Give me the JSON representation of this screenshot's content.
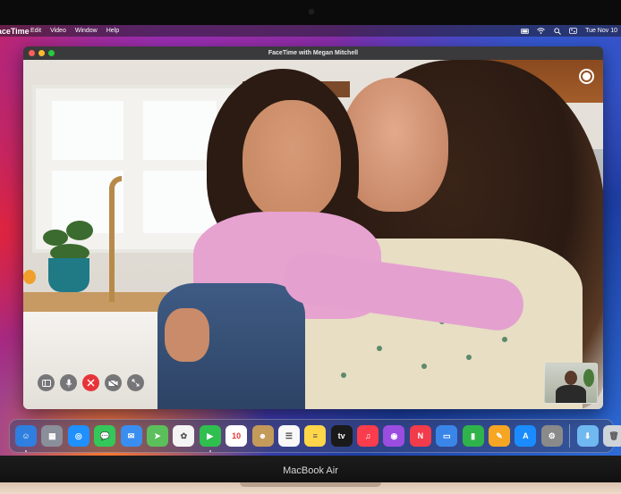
{
  "menubar": {
    "app": "FaceTime",
    "items": [
      "Edit",
      "Video",
      "Window",
      "Help"
    ],
    "clock": "Tue Nov 10",
    "status_icons": [
      "battery-icon",
      "wifi-icon",
      "search-icon",
      "control-center-icon"
    ]
  },
  "window": {
    "title": "FaceTime with Megan Mitchell",
    "controls": [
      "sidebar-icon",
      "mute-icon",
      "end-call-icon",
      "camera-off-icon",
      "fullscreen-icon"
    ],
    "end_color": "#e8333a"
  },
  "dock": {
    "apps": [
      {
        "name": "Finder",
        "icon": "finder-icon",
        "glyph": "☺",
        "color": "#2f7fe0",
        "running": true
      },
      {
        "name": "Launchpad",
        "icon": "launchpad-icon",
        "glyph": "▦",
        "color": "#8a8f99",
        "running": false
      },
      {
        "name": "Safari",
        "icon": "safari-icon",
        "glyph": "◎",
        "color": "#1e90ff",
        "running": false
      },
      {
        "name": "Messages",
        "icon": "messages-icon",
        "glyph": "💬",
        "color": "#34c759",
        "running": false
      },
      {
        "name": "Mail",
        "icon": "mail-icon",
        "glyph": "✉",
        "color": "#3a8ef0",
        "running": false
      },
      {
        "name": "Maps",
        "icon": "maps-icon",
        "glyph": "➤",
        "color": "#5bbf5b",
        "running": false
      },
      {
        "name": "Photos",
        "icon": "photos-icon",
        "glyph": "✿",
        "color": "#f4f4f4",
        "running": false
      },
      {
        "name": "FaceTime",
        "icon": "facetime-icon",
        "glyph": "▶",
        "color": "#2fbf4f",
        "running": true
      },
      {
        "name": "Calendar",
        "icon": "calendar-icon",
        "glyph": "10",
        "color": "#ffffff",
        "running": false
      },
      {
        "name": "Contacts",
        "icon": "contacts-icon",
        "glyph": "☻",
        "color": "#c49a5a",
        "running": false
      },
      {
        "name": "Reminders",
        "icon": "reminders-icon",
        "glyph": "☰",
        "color": "#f8f8f8",
        "running": false
      },
      {
        "name": "Notes",
        "icon": "notes-icon",
        "glyph": "≡",
        "color": "#ffd54a",
        "running": false
      },
      {
        "name": "TV",
        "icon": "tv-icon",
        "glyph": "tv",
        "color": "#1a1a1a",
        "running": false
      },
      {
        "name": "Music",
        "icon": "music-icon",
        "glyph": "♫",
        "color": "#fa3c4c",
        "running": false
      },
      {
        "name": "Podcasts",
        "icon": "podcasts-icon",
        "glyph": "◉",
        "color": "#9b4de0",
        "running": false
      },
      {
        "name": "News",
        "icon": "news-icon",
        "glyph": "N",
        "color": "#f23b4b",
        "running": false
      },
      {
        "name": "Keynote",
        "icon": "keynote-icon",
        "glyph": "▭",
        "color": "#3a86e8",
        "running": false
      },
      {
        "name": "Numbers",
        "icon": "numbers-icon",
        "glyph": "▮",
        "color": "#2fb34a",
        "running": false
      },
      {
        "name": "Pages",
        "icon": "pages-icon",
        "glyph": "✎",
        "color": "#f6a623",
        "running": false
      },
      {
        "name": "App Store",
        "icon": "app-store-icon",
        "glyph": "A",
        "color": "#1a8cff",
        "running": false
      },
      {
        "name": "System Preferences",
        "icon": "system-preferences-icon",
        "glyph": "⚙",
        "color": "#8a8a8a",
        "running": false
      }
    ],
    "folder": {
      "name": "Downloads",
      "icon": "downloads-folder-icon",
      "glyph": "⬇",
      "color": "#6fb8f0"
    },
    "trash": {
      "name": "Trash",
      "icon": "trash-icon",
      "glyph": "🗑",
      "color": "#cfd4db"
    }
  },
  "device": {
    "model": "MacBook Air"
  }
}
